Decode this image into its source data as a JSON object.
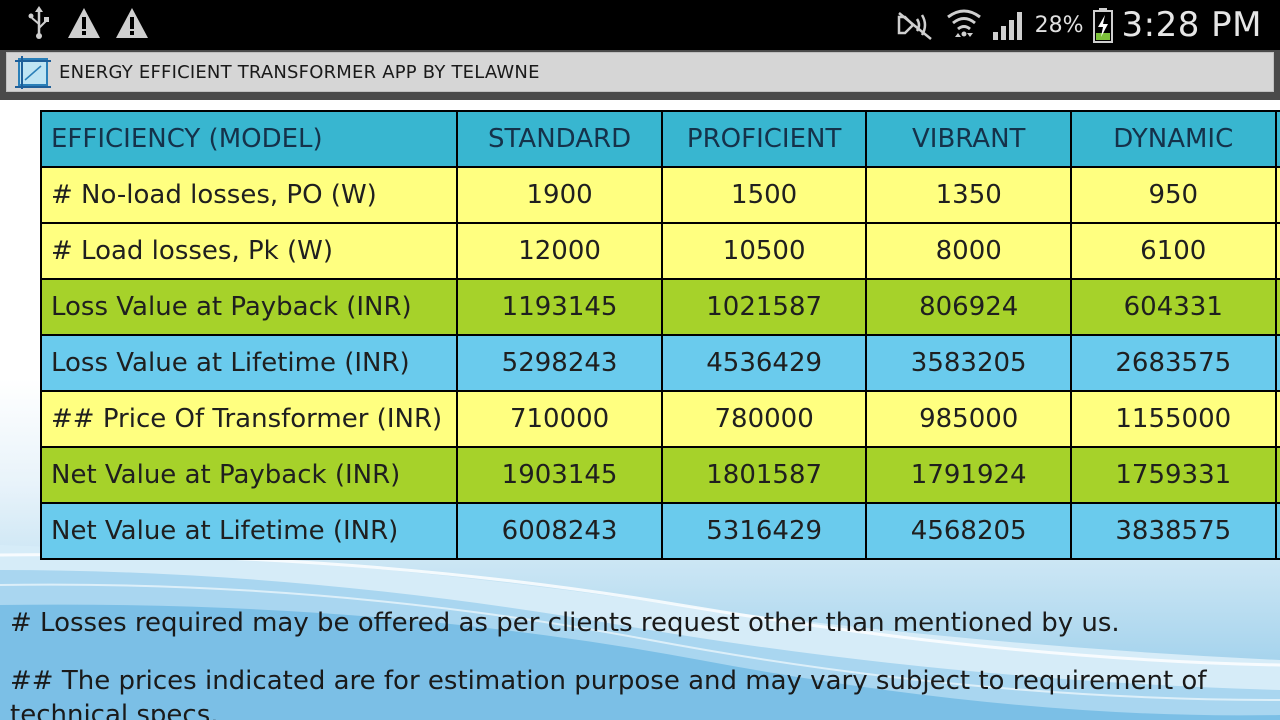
{
  "status_bar": {
    "battery_percent": "28%",
    "time": "3:28 PM",
    "left_icons": [
      "usb-icon",
      "warning-icon",
      "warning-icon"
    ],
    "right_icons": [
      "nfc-mute-icon",
      "wifi-icon",
      "cell-signal-icon",
      "battery-charging-icon"
    ]
  },
  "app": {
    "title": "ENERGY EFFICIENT TRANSFORMER APP BY TELAWNE"
  },
  "table": {
    "header": [
      "EFFICIENCY (MODEL)",
      "STANDARD",
      "PROFICIENT",
      "VIBRANT",
      "DYNAMIC",
      ""
    ],
    "rows": [
      {
        "style": "yellow",
        "cells": [
          "# No-load losses, PO (W)",
          "1900",
          "1500",
          "1350",
          "950",
          ""
        ]
      },
      {
        "style": "yellow",
        "cells": [
          "# Load losses, Pk (W)",
          "12000",
          "10500",
          "8000",
          "6100",
          ""
        ]
      },
      {
        "style": "green",
        "cells": [
          "Loss Value at Payback (INR)",
          "1193145",
          "1021587",
          "806924",
          "604331",
          ""
        ]
      },
      {
        "style": "blue",
        "cells": [
          "Loss Value at Lifetime (INR)",
          "5298243",
          "4536429",
          "3583205",
          "2683575",
          ""
        ]
      },
      {
        "style": "yellow",
        "cells": [
          "## Price Of Transformer (INR)",
          "710000",
          "780000",
          "985000",
          "1155000",
          ""
        ]
      },
      {
        "style": "green",
        "cells": [
          "Net Value at Payback (INR)",
          "1903145",
          "1801587",
          "1791924",
          "1759331",
          ""
        ]
      },
      {
        "style": "blue",
        "cells": [
          "Net Value at Lifetime (INR)",
          "6008243",
          "5316429",
          "4568205",
          "3838575",
          ""
        ]
      }
    ]
  },
  "notes": {
    "losses": "# Losses required may be offered as per clients request other than mentioned by us.",
    "prices_line1": "## The prices indicated are for estimation purpose and may vary subject to requirement of",
    "prices_line2": "technical specs."
  }
}
